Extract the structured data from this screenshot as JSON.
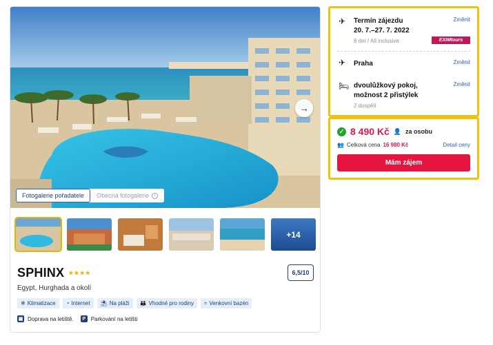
{
  "gallery": {
    "tabs": [
      "Fotogalerie pořadatele",
      "Obecná fotogalerie"
    ],
    "more_label": "+14"
  },
  "hotel": {
    "name": "SPHINX",
    "stars": "★★★★",
    "location": "Egypt, Hurghada a okolí",
    "rating": "6,5/10",
    "amenities": [
      {
        "icon": "snowflake-icon",
        "label": "Klimatizace"
      },
      {
        "icon": "wifi-icon",
        "label": "Internet"
      },
      {
        "icon": "beach-icon",
        "label": "Na pláži"
      },
      {
        "icon": "family-icon",
        "label": "Vhodné pro rodiny"
      },
      {
        "icon": "pool-icon",
        "label": "Venkovní bazén"
      }
    ],
    "transport": [
      {
        "icon": "bus-icon",
        "label": "Doprava na letiště."
      },
      {
        "icon": "parking-icon",
        "label": "Parkování na letišti"
      }
    ]
  },
  "trip": {
    "change_label": "Změnit",
    "term_title": "Termín zájezdu",
    "term_dates": "20. 7.–27. 7. 2022",
    "term_sub": "8 dní / All inclusive",
    "operator_badge": "EXIMtours",
    "departure": "Praha",
    "room_line1": "dvoulůžkový pokoj,",
    "room_line2": "možnost 2 přistýlek",
    "room_sub": "2 dospělí"
  },
  "pricing": {
    "price": "8 490 Kč",
    "per_person": "za osobu",
    "total_label": "Celková cena",
    "total_price": "16 980 Kč",
    "detail_link": "Detail ceny",
    "cta": "Mám zájem"
  },
  "colors": {
    "accent_red": "#e5153f",
    "price_red": "#d8194c",
    "highlight_yellow": "#f0c20a",
    "link_blue": "#2a62b8",
    "success_green": "#1fa32a"
  }
}
